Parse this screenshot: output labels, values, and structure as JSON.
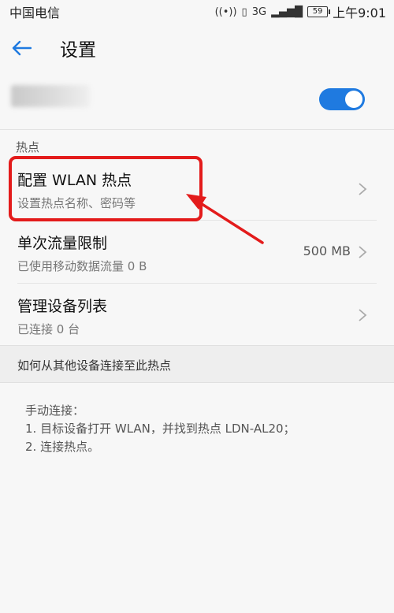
{
  "status_bar": {
    "carrier": "中国电信",
    "signal_label": "3G",
    "battery": "59",
    "time": "上午9:01"
  },
  "header": {
    "title": "设置",
    "back_icon": "back-arrow-icon"
  },
  "hotspot_toggle": {
    "on": true,
    "color": "#1f7ae0"
  },
  "sections": {
    "hotspot_header": "热点"
  },
  "items": [
    {
      "title": "配置 WLAN 热点",
      "subtitle": "设置热点名称、密码等",
      "value": ""
    },
    {
      "title": "单次流量限制",
      "subtitle": "已使用移动数据流量 0 B",
      "value": "500 MB"
    },
    {
      "title": "管理设备列表",
      "subtitle": "已连接 0 台",
      "value": ""
    }
  ],
  "connect_section": {
    "header": "如何从其他设备连接至此热点",
    "line1": "手动连接：",
    "line2": "1. 目标设备打开 WLAN，并找到热点 LDN-AL20；",
    "line3": "2. 连接热点。"
  },
  "annotation": {
    "color": "#e31b1b"
  }
}
